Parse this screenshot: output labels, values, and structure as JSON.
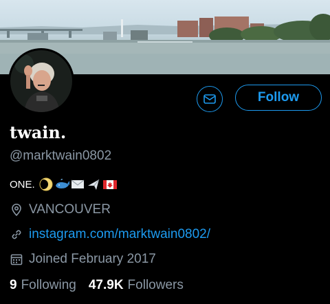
{
  "profile": {
    "display_name": "twain.",
    "handle": "@marktwain0802",
    "bio_text": "ONE.",
    "bio_emojis": [
      "moon-emoji",
      "whale-emoji",
      "envelope-emoji",
      "airplane-emoji",
      "canada-flag-emoji"
    ],
    "location": "VANCOUVER",
    "website": "instagram.com/marktwain0802/",
    "joined": "Joined February 2017"
  },
  "actions": {
    "message_icon": "envelope-icon",
    "follow_label": "Follow"
  },
  "stats": {
    "following_count": "9",
    "following_label": "Following",
    "followers_count": "47.9K",
    "followers_label": "Followers"
  },
  "colors": {
    "accent": "#1d9bf0",
    "background": "#000000",
    "secondary_text": "#8b98a5"
  }
}
